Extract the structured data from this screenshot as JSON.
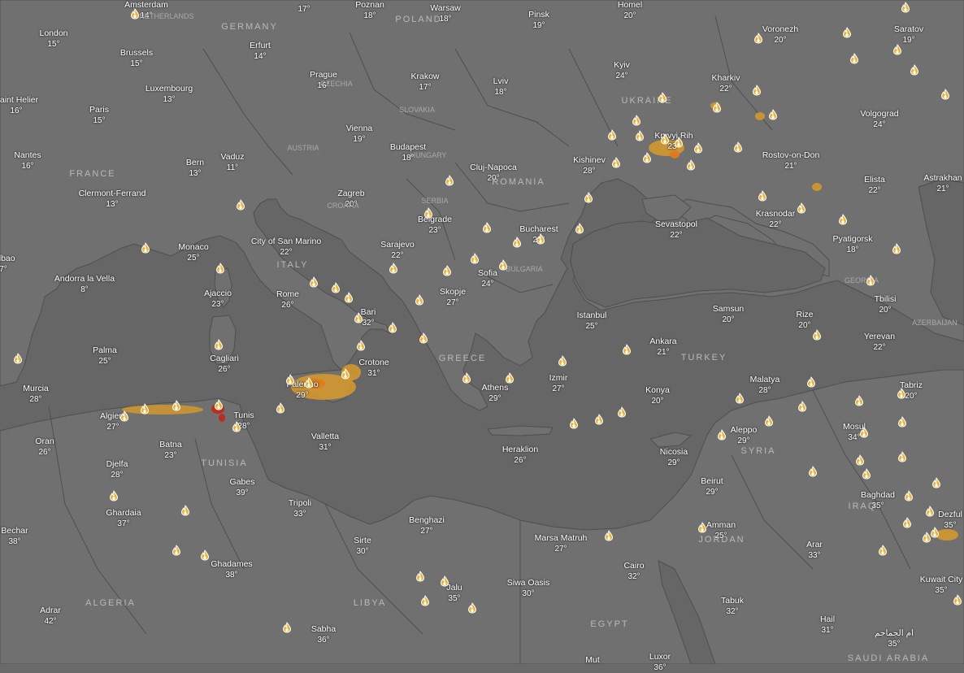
{
  "map": {
    "colors": {
      "sea": "#666666",
      "land": "#707070",
      "border": "#4f4f4f",
      "fire_low": "#d89a2a",
      "fire_mid": "#e07a1e",
      "fire_high": "#c0281c",
      "label_text": "#ffffff",
      "country_text": "#b9b9b9"
    },
    "cities": [
      {
        "name": "Amsterdam",
        "temp": "14°"
      },
      {
        "name": "Warsaw",
        "temp": "18°"
      },
      {
        "name": "Pinsk",
        "temp": "19°"
      },
      {
        "name": "Homel",
        "temp": "20°"
      },
      {
        "name": "Saratov",
        "temp": "19°"
      },
      {
        "name": "London",
        "temp": "15°"
      },
      {
        "name": "Erfurt",
        "temp": "14°"
      },
      {
        "name": "Voronezh",
        "temp": "20°"
      },
      {
        "name": "Brussels",
        "temp": "15°"
      },
      {
        "name": "Prague",
        "temp": "16°"
      },
      {
        "name": "Krakow",
        "temp": "17°"
      },
      {
        "name": "Kyiv",
        "temp": "24°"
      },
      {
        "name": "Kharkiv",
        "temp": "22°"
      },
      {
        "name": "Luxembourg",
        "temp": "13°"
      },
      {
        "name": "Lviv",
        "temp": "18°"
      },
      {
        "name": "Saint Helier",
        "temp": "16°"
      },
      {
        "name": "Paris",
        "temp": "15°"
      },
      {
        "name": "Volgograd",
        "temp": "24°"
      },
      {
        "name": "Vienna",
        "temp": "19°"
      },
      {
        "name": "Budapest",
        "temp": "18°"
      },
      {
        "name": "Kryvyi Rih",
        "temp": "23°"
      },
      {
        "name": "Nantes",
        "temp": "16°"
      },
      {
        "name": "Vaduz",
        "temp": "11°"
      },
      {
        "name": "Bern",
        "temp": "13°"
      },
      {
        "name": "Kishinev",
        "temp": "28°"
      },
      {
        "name": "Rostov-on-Don",
        "temp": "21°"
      },
      {
        "name": "Cluj-Napoca",
        "temp": "20°"
      },
      {
        "name": "Astrakhan",
        "temp": "21°"
      },
      {
        "name": "Elista",
        "temp": "22°"
      },
      {
        "name": "Clermont-Ferrand",
        "temp": "13°"
      },
      {
        "name": "Zagreb",
        "temp": "20°"
      },
      {
        "name": "Belgrade",
        "temp": "23°"
      },
      {
        "name": "Krasnodar",
        "temp": "22°"
      },
      {
        "name": "Sevastopol",
        "temp": "22°"
      },
      {
        "name": "Bucharest",
        "temp": "29°"
      },
      {
        "name": "City of San Marino",
        "temp": "22°"
      },
      {
        "name": "Pyatigorsk",
        "temp": "18°"
      },
      {
        "name": "Sarajevo",
        "temp": "22°"
      },
      {
        "name": "Monaco",
        "temp": "25°"
      },
      {
        "name": "Sofia",
        "temp": "24°"
      },
      {
        "name": "Andorra la Vella",
        "temp": "8°"
      },
      {
        "name": "Ajaccio",
        "temp": "23°"
      },
      {
        "name": "Skopje",
        "temp": "27°"
      },
      {
        "name": "Rome",
        "temp": "26°"
      },
      {
        "name": "Tbilisi",
        "temp": "20°"
      },
      {
        "name": "Bari",
        "temp": "32°"
      },
      {
        "name": "Samsun",
        "temp": "20°"
      },
      {
        "name": "Istanbul",
        "temp": "25°"
      },
      {
        "name": "Rize",
        "temp": "20°"
      },
      {
        "name": "Yerevan",
        "temp": "22°"
      },
      {
        "name": "Ankara",
        "temp": "21°"
      },
      {
        "name": "Palma",
        "temp": "25°"
      },
      {
        "name": "Cagliari",
        "temp": "26°"
      },
      {
        "name": "Crotone",
        "temp": "31°"
      },
      {
        "name": "Izmir",
        "temp": "27°"
      },
      {
        "name": "Malatya",
        "temp": "28°"
      },
      {
        "name": "Tabriz",
        "temp": "20°"
      },
      {
        "name": "Palermo",
        "temp": "29°"
      },
      {
        "name": "Athens",
        "temp": "29°"
      },
      {
        "name": "Konya",
        "temp": "20°"
      },
      {
        "name": "Murcia",
        "temp": "28°"
      },
      {
        "name": "Algiers",
        "temp": "27°"
      },
      {
        "name": "Tunis",
        "temp": "28°"
      },
      {
        "name": "Mosul",
        "temp": "34°"
      },
      {
        "name": "Aleppo",
        "temp": "29°"
      },
      {
        "name": "Oran",
        "temp": "26°"
      },
      {
        "name": "Valletta",
        "temp": "31°"
      },
      {
        "name": "Batna",
        "temp": "23°"
      },
      {
        "name": "Heraklion",
        "temp": "26°"
      },
      {
        "name": "Nicosia",
        "temp": "29°"
      },
      {
        "name": "Djelfa",
        "temp": "28°"
      },
      {
        "name": "Gabes",
        "temp": "39°"
      },
      {
        "name": "Beirut",
        "temp": "29°"
      },
      {
        "name": "Baghdad",
        "temp": "35°"
      },
      {
        "name": "Tripoli",
        "temp": "33°"
      },
      {
        "name": "Ghardaia",
        "temp": "37°"
      },
      {
        "name": "Dezful",
        "temp": "35°"
      },
      {
        "name": "Amman",
        "temp": "25°"
      },
      {
        "name": "Benghazi",
        "temp": "27°"
      },
      {
        "name": "Bechar",
        "temp": "38°"
      },
      {
        "name": "Marsa Matruh",
        "temp": "27°"
      },
      {
        "name": "Sirte",
        "temp": "30°"
      },
      {
        "name": "Arar",
        "temp": "33°"
      },
      {
        "name": "Ghadames",
        "temp": "38°"
      },
      {
        "name": "Cairo",
        "temp": "32°"
      },
      {
        "name": "Siwa Oasis",
        "temp": "30°"
      },
      {
        "name": "Jalu",
        "temp": "35°"
      },
      {
        "name": "Kuwait City",
        "temp": "35°"
      },
      {
        "name": "Tabuk",
        "temp": "32°"
      },
      {
        "name": "Adrar",
        "temp": "42°"
      },
      {
        "name": "Hail",
        "temp": "31°"
      },
      {
        "name": "ام الجماجم",
        "temp": "35°"
      },
      {
        "name": "Sabha",
        "temp": "36°"
      },
      {
        "name": "Luxor",
        "temp": "36°"
      },
      {
        "name": "Mut",
        "temp": ""
      },
      {
        "name": "Poznan",
        "temp": "18°"
      },
      {
        "name": "",
        "temp": "17°"
      },
      {
        "name": "Bilbao",
        "temp": "7°"
      },
      {
        "name": "",
        "temp": ""
      }
    ],
    "countries": [
      "GERMANY",
      "POLAND",
      "UKRAINE",
      "FRANCE",
      "ROMANIA",
      "ITALY",
      "GREECE",
      "TURKEY",
      "ALGERIA",
      "LIBYA",
      "EGYPT",
      "SAUDI ARABIA",
      "SYRIA",
      "TUNISIA",
      "JORDAN",
      "IRAQ"
    ],
    "regions": [
      "NETHERLANDS",
      "CZECHIA",
      "SLOVAKIA",
      "AUSTRIA",
      "HUNGARY",
      "CROATIA",
      "SERBIA",
      "BULGARIA",
      "GEORGIA",
      "AZERBAIJAN"
    ]
  }
}
